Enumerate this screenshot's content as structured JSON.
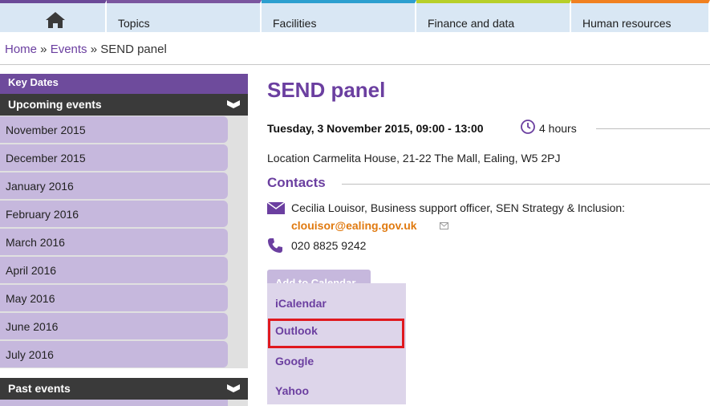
{
  "nav": {
    "tabs": [
      {
        "label": "Topics"
      },
      {
        "label": "Facilities"
      },
      {
        "label": "Finance and data"
      },
      {
        "label": "Human resources"
      }
    ],
    "home_icon": "home-icon"
  },
  "breadcrumb": {
    "home": "Home",
    "sep1": " » ",
    "events": "Events",
    "sep2": " » ",
    "current": "SEND panel"
  },
  "sidebar": {
    "key_dates": "Key Dates",
    "upcoming": "Upcoming events",
    "months": [
      "November 2015",
      "December 2015",
      "January 2016",
      "February 2016",
      "March 2016",
      "April 2016",
      "May 2016",
      "June 2016",
      "July 2016"
    ],
    "past": "Past events"
  },
  "event": {
    "title": "SEND panel",
    "datetime": "Tuesday, 3 November 2015, 09:00 - 13:00",
    "duration": "4 hours",
    "location": "Location Carmelita House, 21-22 The Mall, Ealing, W5 2PJ",
    "contacts_heading": "Contacts",
    "contact": "Cecilia Louisor, Business support officer, SEN Strategy & Inclusion:",
    "email": "clouisor@ealing.gov.uk",
    "phone": "020 8825 9242"
  },
  "calendar": {
    "button_label": "Add to Calendar",
    "options": [
      "iCalendar",
      "Outlook",
      "Google",
      "Yahoo"
    ],
    "highlighted": "Outlook"
  },
  "colors": {
    "purple": "#6b3fa0",
    "orange_link": "#e07a10",
    "highlight_red": "#e0191f"
  }
}
